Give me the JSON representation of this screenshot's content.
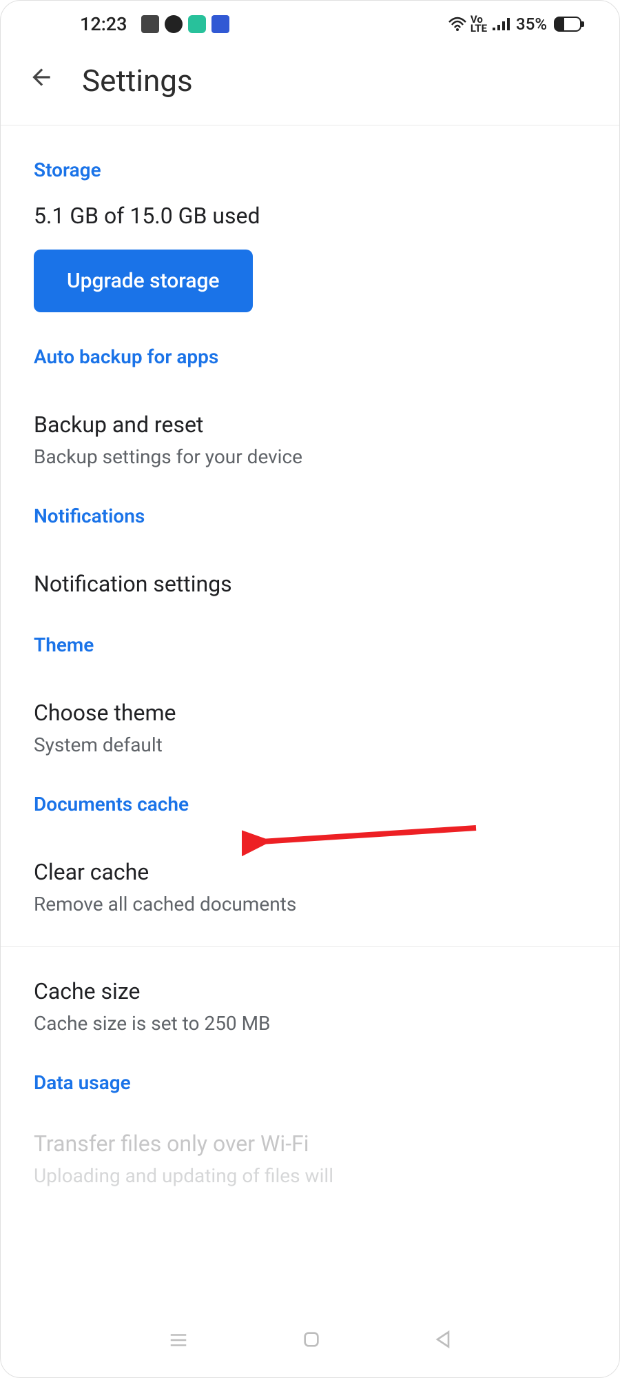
{
  "status_bar": {
    "time": "12:23",
    "battery_percent": "35%"
  },
  "header": {
    "title": "Settings"
  },
  "storage": {
    "header": "Storage",
    "usage": "5.1 GB of 15.0 GB used",
    "upgrade_button": "Upgrade storage"
  },
  "auto_backup": {
    "header": "Auto backup for apps",
    "title": "Backup and reset",
    "subtitle": "Backup settings for your device"
  },
  "notifications": {
    "header": "Notifications",
    "title": "Notification settings"
  },
  "theme": {
    "header": "Theme",
    "title": "Choose theme",
    "subtitle": "System default"
  },
  "documents_cache": {
    "header": "Documents cache",
    "clear_title": "Clear cache",
    "clear_subtitle": "Remove all cached documents",
    "size_title": "Cache size",
    "size_subtitle": "Cache size is set to 250 MB"
  },
  "data_usage": {
    "header": "Data usage",
    "title": "Transfer files only over Wi-Fi",
    "subtitle": "Uploading and updating of files will"
  }
}
